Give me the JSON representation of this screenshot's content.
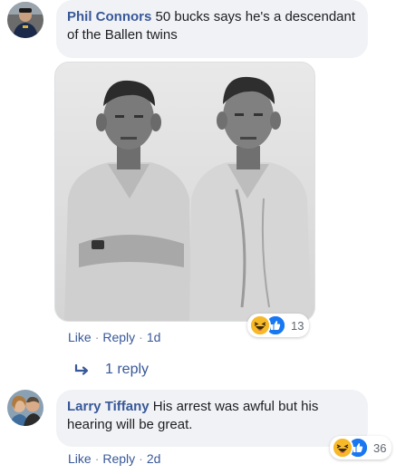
{
  "comments": [
    {
      "author": "Phil Connors",
      "text": " 50 bucks says he's a descendant of the Ballen twins",
      "actions": {
        "like": "Like",
        "reply": "Reply",
        "time": "1d"
      },
      "reaction_count": "13",
      "reactions": [
        "haha-icon",
        "like-icon"
      ]
    },
    {
      "author": "Larry Tiffany",
      "text": " His arrest was awful but his hearing will be great.",
      "actions": {
        "like": "Like",
        "reply": "Reply",
        "time": "2d"
      },
      "reaction_count": "36",
      "reactions": [
        "haha-icon",
        "like-icon"
      ]
    }
  ],
  "replies_link": {
    "label": "1 reply",
    "icon": "reply-arrow-icon"
  },
  "separator": "·",
  "colors": {
    "link": "#385898",
    "bubble": "#f0f2f5",
    "like_blue": "#1877f2",
    "haha_yellow": "#f7b928"
  }
}
